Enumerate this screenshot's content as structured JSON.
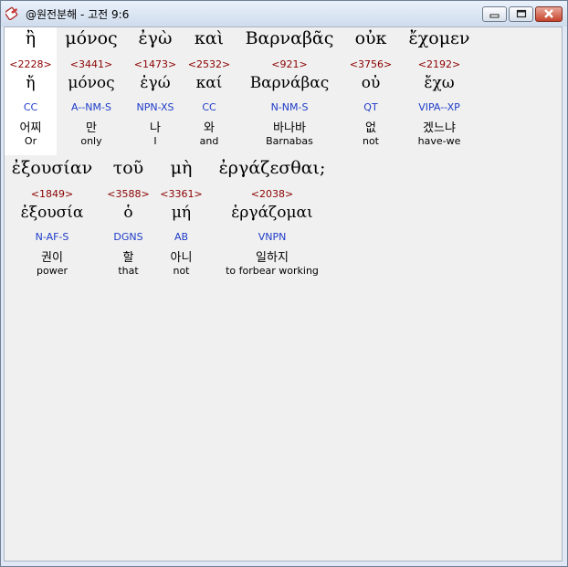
{
  "window": {
    "title": "@원전분해 - 고전 9:6"
  },
  "rows": [
    {
      "words": [
        {
          "greek": "ἢ",
          "strong": "<2228>",
          "lemma": "ἤ",
          "morph": "CC",
          "korean": "어찌",
          "english": "Or",
          "highlighted": true
        },
        {
          "greek": "μόνος",
          "strong": "<3441>",
          "lemma": "μόνος",
          "morph": "A--NM-S",
          "korean": "만",
          "english": "only"
        },
        {
          "greek": "ἐγὼ",
          "strong": "<1473>",
          "lemma": "ἐγώ",
          "morph": "NPN-XS",
          "korean": "나",
          "english": "I"
        },
        {
          "greek": "καὶ",
          "strong": "<2532>",
          "lemma": "καί",
          "morph": "CC",
          "korean": "와",
          "english": "and"
        },
        {
          "greek": "Βαρναβᾶς",
          "strong": "<921>",
          "lemma": "Βαρνάβας",
          "morph": "N-NM-S",
          "korean": "바나바",
          "english": "Barnabas"
        },
        {
          "greek": "οὐκ",
          "strong": "<3756>",
          "lemma": "οὐ",
          "morph": "QT",
          "korean": "없",
          "english": "not"
        },
        {
          "greek": "ἔχομεν",
          "strong": "<2192>",
          "lemma": "ἔχω",
          "morph": "VIPA--XP",
          "korean": "겠느냐",
          "english": "have-we"
        }
      ]
    },
    {
      "words": [
        {
          "greek": "ἐξουσίαν",
          "strong": "<1849>",
          "lemma": "ἐξουσία",
          "morph": "N-AF-S",
          "korean": "권이",
          "english": "power"
        },
        {
          "greek": "τοῦ",
          "strong": "<3588>",
          "lemma": "ὁ",
          "morph": "DGNS",
          "korean": "할",
          "english": "that"
        },
        {
          "greek": "μὴ",
          "strong": "<3361>",
          "lemma": "μή",
          "morph": "AB",
          "korean": "아니",
          "english": "not"
        },
        {
          "greek": "ἐργάζεσθαι;",
          "strong": "<2038>",
          "lemma": "ἐργάζομαι",
          "morph": "VNPN",
          "korean": "일하지",
          "english": "to forbear working"
        }
      ]
    }
  ]
}
